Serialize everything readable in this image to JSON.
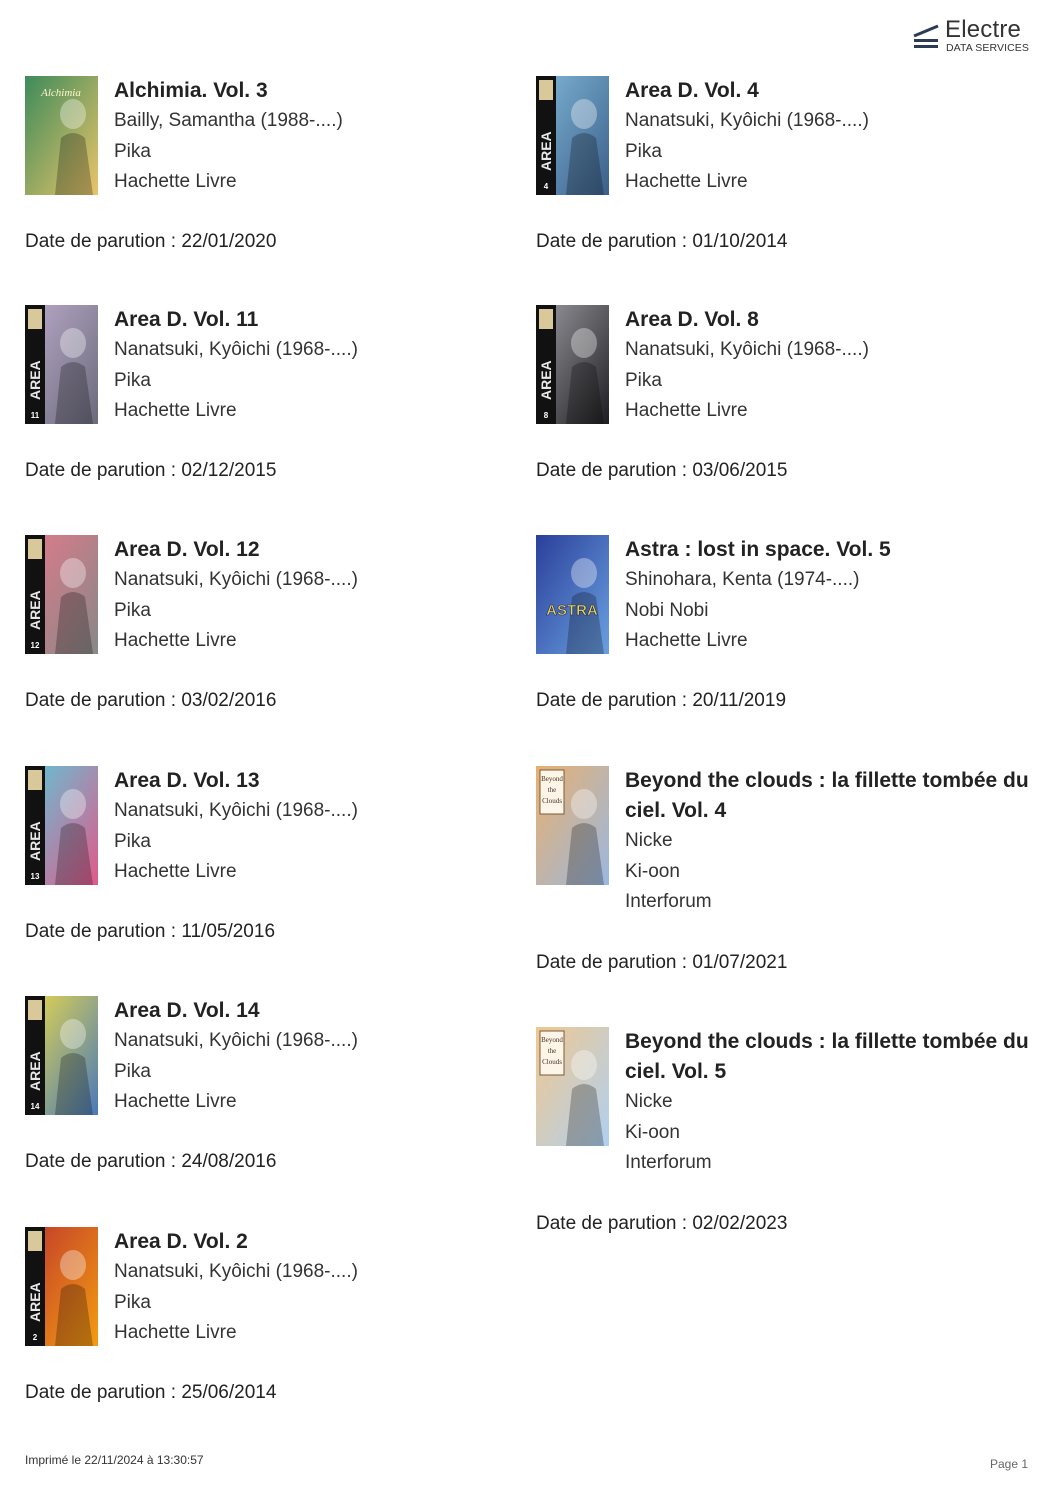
{
  "brand": {
    "name": "Electre",
    "subtitle": "DATA SERVICES"
  },
  "date_prefix": "Date de parution : ",
  "left_column": [
    {
      "title": "Alchimia. Vol. 3",
      "author": "Bailly, Samantha (1988-....)",
      "publisher": "Pika",
      "distributor": "Hachette Livre",
      "date": "22/01/2020",
      "cover_text": "Alchimia",
      "cover_colors": [
        "#3d8b5a",
        "#e9c46a"
      ]
    },
    {
      "title": "Area D. Vol. 11",
      "author": "Nanatsuki, Kyôichi (1968-....)",
      "publisher": "Pika",
      "distributor": "Hachette Livre",
      "date": "02/12/2015",
      "cover_text": "AREA",
      "cover_number": "11",
      "cover_colors": [
        "#b9a9c9",
        "#6b6b7b"
      ]
    },
    {
      "title": "Area D. Vol. 12",
      "author": "Nanatsuki, Kyôichi (1968-....)",
      "publisher": "Pika",
      "distributor": "Hachette Livre",
      "date": "03/02/2016",
      "cover_text": "AREA",
      "cover_number": "12",
      "cover_colors": [
        "#e07a8a",
        "#888888"
      ]
    },
    {
      "title": "Area D. Vol. 13",
      "author": "Nanatsuki, Kyôichi (1968-....)",
      "publisher": "Pika",
      "distributor": "Hachette Livre",
      "date": "11/05/2016",
      "cover_text": "AREA",
      "cover_number": "13",
      "cover_colors": [
        "#5ec6d8",
        "#e05a8a"
      ]
    },
    {
      "title": "Area D. Vol. 14",
      "author": "Nanatsuki, Kyôichi (1968-....)",
      "publisher": "Pika",
      "distributor": "Hachette Livre",
      "date": "24/08/2016",
      "cover_text": "AREA",
      "cover_number": "14",
      "cover_colors": [
        "#e8d84a",
        "#4a7ab8"
      ]
    },
    {
      "title": "Area D. Vol. 2",
      "author": "Nanatsuki, Kyôichi (1968-....)",
      "publisher": "Pika",
      "distributor": "Hachette Livre",
      "date": "25/06/2014",
      "cover_text": "AREA",
      "cover_number": "2",
      "cover_colors": [
        "#c0392b",
        "#f39c12"
      ]
    }
  ],
  "right_column": [
    {
      "title": "Area D. Vol. 4",
      "author": "Nanatsuki, Kyôichi (1968-....)",
      "publisher": "Pika",
      "distributor": "Hachette Livre",
      "date": "01/10/2014",
      "cover_text": "AREA",
      "cover_number": "4",
      "cover_colors": [
        "#7fb6d6",
        "#3b5f8a"
      ]
    },
    {
      "title": "Area D. Vol. 8",
      "author": "Nanatsuki, Kyôichi (1968-....)",
      "publisher": "Pika",
      "distributor": "Hachette Livre",
      "date": "03/06/2015",
      "cover_text": "AREA",
      "cover_number": "8",
      "cover_colors": [
        "#9a9aa0",
        "#1e1e22"
      ]
    },
    {
      "title": "Astra : lost in space. Vol. 5",
      "author": "Shinohara, Kenta (1974-....)",
      "publisher": "Nobi Nobi",
      "distributor": "Hachette Livre",
      "date": "20/11/2019",
      "cover_text": "ASTRA",
      "cover_colors": [
        "#2a3f9a",
        "#6aa0e0"
      ]
    },
    {
      "title": "Beyond the clouds : la fillette tombée du ciel. Vol. 4",
      "author": "Nicke",
      "publisher": "Ki-oon",
      "distributor": "Interforum",
      "date": "01/07/2021",
      "cover_text": "Beyond the Clouds",
      "cover_colors": [
        "#e8b070",
        "#9ab8e0"
      ]
    },
    {
      "title": "Beyond the clouds : la fillette tombée du ciel. Vol. 5",
      "author": "Nicke",
      "publisher": "Ki-oon",
      "distributor": "Interforum",
      "date": "02/02/2023",
      "cover_text": "Beyond the Clouds",
      "cover_colors": [
        "#f0c890",
        "#b0d0f0"
      ]
    }
  ],
  "footer": {
    "printed": "Imprimé le 22/11/2024 à 13:30:57",
    "page": "Page 1"
  }
}
